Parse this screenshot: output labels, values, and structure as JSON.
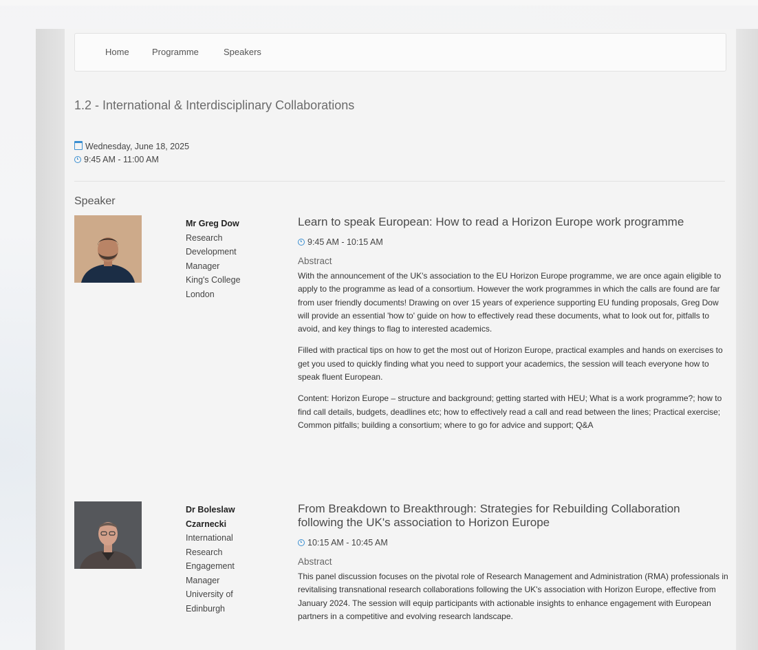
{
  "nav": {
    "items": [
      "Home",
      "Programme",
      "Speakers"
    ]
  },
  "session": {
    "title": "1.2 - International & Interdisciplinary Collaborations",
    "date": "Wednesday, June 18, 2025",
    "time": "9:45 AM - 11:00 AM"
  },
  "speakers_heading": "Speaker",
  "speakers": [
    {
      "name": "Mr Greg Dow",
      "role": "Research Development Manager",
      "org": "King's College London",
      "talk_title": "Learn to speak European: How to read a Horizon Europe work programme",
      "talk_time": "9:45 AM - 10:15 AM",
      "abstract_label": "Abstract",
      "abstract_paragraphs": [
        "With the announcement of the UK's association to the EU Horizon Europe programme, we are once again eligible to apply to the programme as lead of a consortium. However the work programmes in which the calls are found are far from user friendly documents! Drawing on over 15 years of experience supporting EU funding proposals, Greg Dow will provide an essential 'how to' guide on how to effectively read these documents, what to look out for, pitfalls to avoid, and key things to flag to interested academics.",
        "Filled with practical tips on how to get the most out of Horizon Europe, practical examples and hands on exercises to get you used to quickly finding what you need to support your academics, the session will teach everyone how to speak fluent European.",
        "Content: Horizon Europe – structure and background; getting started with HEU; What is a work programme?; how to find call details, budgets, deadlines etc; how to effectively read a call and read between the lines; Practical exercise; Common pitfalls; building a consortium; where to go for advice and support; Q&A"
      ]
    },
    {
      "name": "Dr Boleslaw Czarnecki",
      "role": "International Research Engagement Manager",
      "org": "University of Edinburgh",
      "talk_title": "From Breakdown to Breakthrough: Strategies for Rebuilding Collaboration following the UK's association to Horizon Europe",
      "talk_time": "10:15 AM - 10:45 AM",
      "abstract_label": "Abstract",
      "abstract_paragraphs": [
        "This panel discussion focuses on the pivotal role of Research Management and Administration (RMA) professionals in revitalising transnational research collaborations following the UK's association with Horizon Europe, effective from January 2024. The session will equip participants with actionable insights to enhance engagement with European partners in a competitive and evolving research landscape."
      ]
    }
  ],
  "icons": {
    "date": "calendar-icon",
    "time": "clock-icon"
  },
  "colors": {
    "accent": "#3b8fd1",
    "page_background": "#f4f4f4"
  }
}
